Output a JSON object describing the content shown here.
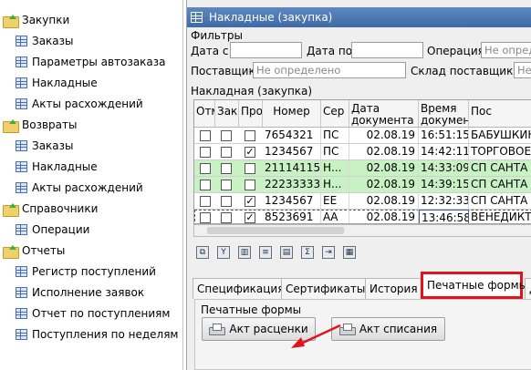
{
  "nav": [
    {
      "type": "category",
      "label": "Закупки",
      "icon": "folder-icon"
    },
    {
      "type": "item",
      "label": "Заказы",
      "icon": "document-icon"
    },
    {
      "type": "item",
      "label": "Параметры автозаказа",
      "icon": "document-icon"
    },
    {
      "type": "item",
      "label": "Накладные",
      "icon": "document-icon"
    },
    {
      "type": "item",
      "label": "Акты расхождений",
      "icon": "document-icon"
    },
    {
      "type": "category",
      "label": "Возвраты",
      "icon": "folder-icon"
    },
    {
      "type": "item",
      "label": "Заказы",
      "icon": "document-icon"
    },
    {
      "type": "item",
      "label": "Накладные",
      "icon": "document-icon"
    },
    {
      "type": "item",
      "label": "Акты расхождений",
      "icon": "document-icon"
    },
    {
      "type": "category",
      "label": "Справочники",
      "icon": "folder-icon"
    },
    {
      "type": "item",
      "label": "Операции",
      "icon": "document-icon"
    },
    {
      "type": "category",
      "label": "Отчеты",
      "icon": "folder-icon"
    },
    {
      "type": "item",
      "label": "Регистр поступлений",
      "icon": "document-icon"
    },
    {
      "type": "item",
      "label": "Исполнение заявок",
      "icon": "document-icon"
    },
    {
      "type": "item",
      "label": "Отчет по поступлениям",
      "icon": "document-icon"
    },
    {
      "type": "item",
      "label": "Поступления по неделям",
      "icon": "document-icon"
    }
  ],
  "window": {
    "title": "Накладные (закупка)"
  },
  "filters": {
    "section_label": "Фильтры",
    "date_from_label": "Дата с",
    "date_from_value": "",
    "date_to_label": "Дата по",
    "date_to_value": "",
    "operation_label": "Операция",
    "operation_value": "Не опред",
    "supplier_label": "Поставщик",
    "supplier_value": "Не определено",
    "warehouse_label": "Склад поставщика",
    "warehouse_value": "Не"
  },
  "grid": {
    "title": "Накладная (закупка)",
    "columns": [
      "Отм",
      "Зак",
      "Про",
      "Номер",
      "Сер",
      "Дата документа",
      "Время документ",
      "Пос"
    ],
    "rows": [
      {
        "c1": false,
        "c2": false,
        "c3": false,
        "number": "7654321",
        "series": "ПС",
        "date": "02.08.19",
        "time": "16:51:15",
        "supplier": "БАБУШКИН",
        "highlight": false
      },
      {
        "c1": false,
        "c2": false,
        "c3": true,
        "number": "1234567",
        "series": "ПС",
        "date": "02.08.19",
        "time": "14:42:11",
        "supplier": "ТОРГОВОЕ",
        "highlight": false
      },
      {
        "c1": false,
        "c2": false,
        "c3": false,
        "number": "21114115",
        "series": "Н...",
        "date": "02.08.19",
        "time": "14:33:09",
        "supplier": "СП САНТА",
        "highlight": true
      },
      {
        "c1": false,
        "c2": false,
        "c3": false,
        "number": "22233333",
        "series": "Н...",
        "date": "02.08.19",
        "time": "14:39:15",
        "supplier": "СП САНТА",
        "highlight": true
      },
      {
        "c1": false,
        "c2": false,
        "c3": true,
        "number": "1234567",
        "series": "ЕЕ",
        "date": "02.08.19",
        "time": "12:32:33",
        "supplier": "СП САНТА",
        "highlight": false
      },
      {
        "c1": false,
        "c2": false,
        "c3": true,
        "number": "8523691",
        "series": "АА",
        "date": "02.08.19",
        "time": "13:46:58",
        "supplier": "ВЕНЕДИКТ",
        "highlight": false,
        "selected": true
      }
    ]
  },
  "toolbar": {
    "icons": [
      "copy-icon",
      "filter-icon",
      "columns-icon",
      "numbered-list-icon",
      "add-column-icon",
      "sum-icon",
      "export-icon",
      "print-preview-icon"
    ]
  },
  "tabs": [
    {
      "label": "Спецификация",
      "active": false
    },
    {
      "label": "Сертификаты",
      "active": false
    },
    {
      "label": "История",
      "active": false
    },
    {
      "label": "Печатные формы",
      "active": true
    },
    {
      "label": "Д",
      "active": false
    }
  ],
  "print_forms": {
    "section_label": "Печатные формы",
    "buttons": [
      "Акт расценки",
      "Акт списания"
    ]
  },
  "colors": {
    "title_bar": "#4a75ae",
    "highlight_row": "#c8f2c4",
    "annotation_red": "#e2141b"
  }
}
